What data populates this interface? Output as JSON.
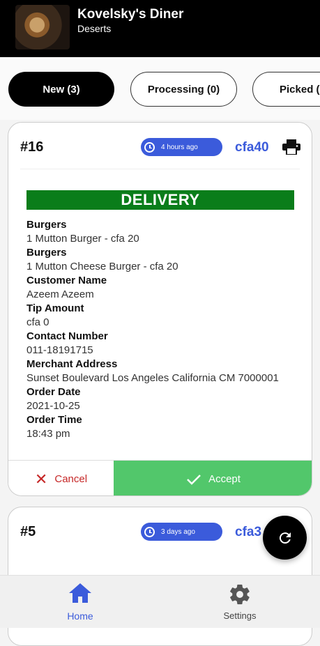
{
  "header": {
    "store_name": "Kovelsky's Diner",
    "store_subtitle": "Deserts"
  },
  "tabs": [
    {
      "label": "New (3)",
      "active": true
    },
    {
      "label": "Processing (0)",
      "active": false
    },
    {
      "label": "Picked (",
      "active": false
    }
  ],
  "orders": [
    {
      "number": "#16",
      "time_ago": "4 hours ago",
      "amount": "cfa40",
      "order_type": "DELIVERY",
      "details": [
        {
          "label": "Burgers",
          "value": "1 Mutton Burger - cfa 20"
        },
        {
          "label": "Burgers",
          "value": "1 Mutton Cheese Burger - cfa 20"
        },
        {
          "label": "Customer Name",
          "value": "Azeem Azeem"
        },
        {
          "label": "Tip Amount",
          "value": "cfa 0"
        },
        {
          "label": "Contact Number",
          "value": "011-18191715"
        },
        {
          "label": "Merchant Address",
          "value": "Sunset Boulevard Los Angeles California CM 7000001"
        },
        {
          "label": "Order Date",
          "value": "2021-10-25"
        },
        {
          "label": "Order Time",
          "value": "18:43 pm"
        }
      ],
      "cancel_label": "Cancel",
      "accept_label": "Accept"
    },
    {
      "number": "#5",
      "time_ago": "3 days ago",
      "amount": "cfa3"
    }
  ],
  "bottom_nav": [
    {
      "label": "Home",
      "icon": "home-icon",
      "active": true
    },
    {
      "label": "Settings",
      "icon": "gear-icon",
      "active": false
    }
  ],
  "colors": {
    "accent": "#3b5bdb",
    "delivery": "#0a7d1a",
    "accept": "#52c76b",
    "cancel": "#c62828"
  }
}
